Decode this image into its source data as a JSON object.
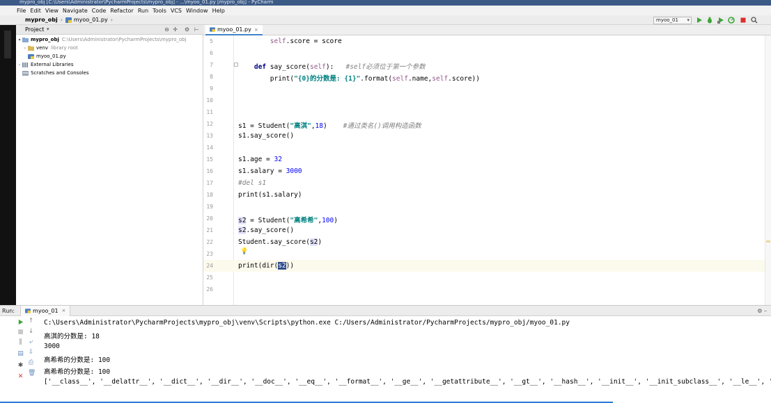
{
  "window": {
    "title": "mypro_obj [C:\\Users\\Administrator\\PycharmProjects\\mypro_obj] - ...\\myoo_01.py [mypro_obj] - PyCharm"
  },
  "menu": [
    "File",
    "Edit",
    "View",
    "Navigate",
    "Code",
    "Refactor",
    "Run",
    "Tools",
    "VCS",
    "Window",
    "Help"
  ],
  "breadcrumb": {
    "project": "mypro_obj",
    "file": "myoo_01.py"
  },
  "toolbar": {
    "run_config": "myoo_01"
  },
  "project_panel": {
    "title": "Project",
    "tree": [
      {
        "label": "mypro_obj",
        "hint": "C:\\Users\\Administrator\\PycharmProjects\\mypro_obj",
        "bold": true
      },
      {
        "label": "venv",
        "hint": "library root",
        "bold": false
      },
      {
        "label": "myoo_01.py",
        "hint": "",
        "bold": false
      },
      {
        "label": "External Libraries",
        "hint": "",
        "bold": false
      },
      {
        "label": "Scratches and Consoles",
        "hint": "",
        "bold": false
      }
    ]
  },
  "editor": {
    "tab": "myoo_01.py",
    "lines": [
      {
        "no": "5",
        "text": "        self.score = score"
      },
      {
        "no": "6",
        "text": ""
      },
      {
        "no": "7",
        "text": "    def say_score(self):   #self必须位于第一个参数"
      },
      {
        "no": "8",
        "text": "        print(\"{0}的分数是: {1}\".format(self.name,self.score))"
      },
      {
        "no": "9",
        "text": ""
      },
      {
        "no": "10",
        "text": ""
      },
      {
        "no": "11",
        "text": ""
      },
      {
        "no": "12",
        "text": "s1 = Student(\"高淇\",18)    #通过类名()调用构造函数"
      },
      {
        "no": "13",
        "text": "s1.say_score()"
      },
      {
        "no": "14",
        "text": ""
      },
      {
        "no": "15",
        "text": "s1.age = 32"
      },
      {
        "no": "16",
        "text": "s1.salary = 3000"
      },
      {
        "no": "17",
        "text": "#del s1"
      },
      {
        "no": "18",
        "text": "print(s1.salary)"
      },
      {
        "no": "19",
        "text": ""
      },
      {
        "no": "20",
        "text": "s2 = Student(\"高希希\",100)"
      },
      {
        "no": "21",
        "text": "s2.say_score()"
      },
      {
        "no": "22",
        "text": "Student.say_score(s2)"
      },
      {
        "no": "23",
        "text": ""
      },
      {
        "no": "24",
        "text": "print(dir(s2))"
      },
      {
        "no": "25",
        "text": ""
      },
      {
        "no": "26",
        "text": ""
      }
    ],
    "current_line": "24"
  },
  "run_panel": {
    "label": "Run:",
    "tab": "myoo_01",
    "output": [
      "C:\\Users\\Administrator\\PycharmProjects\\mypro_obj\\venv\\Scripts\\python.exe C:/Users/Administrator/PycharmProjects/mypro_obj/myoo_01.py",
      "高淇的分数是: 18",
      "3000",
      "高希希的分数是: 100",
      "高希希的分数是: 100",
      "['__class__', '__delattr__', '__dict__', '__dir__', '__doc__', '__eq__', '__format__', '__ge__', '__getattribute__', '__gt__', '__hash__', '__init__', '__init_subclass__', '__le__', '__"
    ]
  },
  "colors": {
    "keyword": "#000080",
    "self": "#94558d",
    "string": "#008080",
    "number": "#0000ff",
    "comment": "#808080",
    "run_green": "#3aa635",
    "stop_red": "#d9302c",
    "selection": "#2d4b8c"
  },
  "icons": [
    "run-icon",
    "debug-icon",
    "coverage-icon",
    "profile-icon",
    "stop-icon",
    "search-icon",
    "gear-icon",
    "folder-icon",
    "python-file-icon",
    "bulb-icon"
  ]
}
